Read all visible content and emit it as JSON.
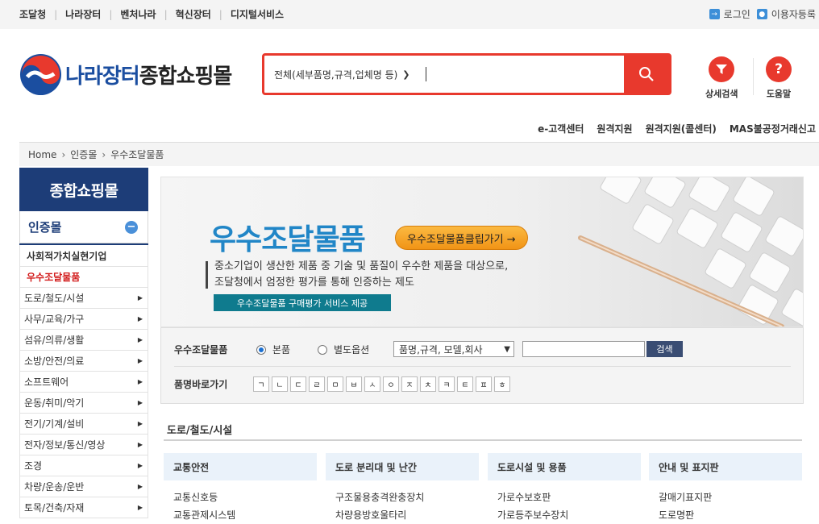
{
  "top_nav": [
    "조달청",
    "나라장터",
    "벤처나라",
    "혁신장터",
    "디지털서비스"
  ],
  "util": {
    "login": "로그인",
    "register": "이용자등록"
  },
  "logo": {
    "part1": "나라장터",
    "part2": "종합쇼핑몰"
  },
  "search": {
    "category": "전체(세부품명,규격,업체명 등)",
    "value": ""
  },
  "header_icons": {
    "detail_search": "상세검색",
    "help": "도움말"
  },
  "sub_links": [
    "e-고객센터",
    "원격지원",
    "원격지원(콜센터)",
    "MAS불공정거래신고"
  ],
  "breadcrumb": [
    "Home",
    "인증몰",
    "우수조달물품"
  ],
  "sidebar": {
    "title": "종합쇼핑몰",
    "section": "인증몰",
    "items": [
      "사회적가치실현기업",
      "우수조달물품",
      "도로/철도/시설",
      "사무/교육/가구",
      "섬유/의류/생활",
      "소방/안전/의료",
      "소프트웨어",
      "운동/취미/악기",
      "전기/기계/설비",
      "전자/정보/통신/영상",
      "조경",
      "차량/운송/운반",
      "토목/건축/자재"
    ]
  },
  "banner": {
    "title": "우수조달물품",
    "button": "우수조달물품클립가기 →",
    "desc1": "중소기업이 생산한 제품 중 기술 및 품질이 우수한 제품을 대상으로,",
    "desc2": "조달청에서 엄정한 평가를 통해 인증하는 제도",
    "service": "우수조달물품 구매평가 서비스 제공"
  },
  "filter": {
    "label": "우수조달물품",
    "radio1": "본품",
    "radio2": "별도옵션",
    "select": "품명,규격, 모델,회사",
    "search_btn": "검색",
    "jamo_label": "품명바로가기",
    "jamo": [
      "ㄱ",
      "ㄴ",
      "ㄷ",
      "ㄹ",
      "ㅁ",
      "ㅂ",
      "ㅅ",
      "ㅇ",
      "ㅈ",
      "ㅊ",
      "ㅋ",
      "ㅌ",
      "ㅍ",
      "ㅎ"
    ]
  },
  "category": {
    "title": "도로/철도/시설",
    "columns": [
      {
        "head": "교통안전",
        "items": [
          "교통신호등",
          "교통관제시스템"
        ]
      },
      {
        "head": "도로 분리대 및 난간",
        "items": [
          "구조물용충격완충장치",
          "차량용방호울타리"
        ]
      },
      {
        "head": "도로시설 및 용품",
        "items": [
          "가로수보호판",
          "가로등주보수장치"
        ]
      },
      {
        "head": "안내 및 표지판",
        "items": [
          "갈매기표지판",
          "도로명판"
        ]
      }
    ]
  },
  "colors": {
    "accent": "#e8392d",
    "navy": "#1d3d78",
    "brand_blue": "#1b4ea0"
  }
}
